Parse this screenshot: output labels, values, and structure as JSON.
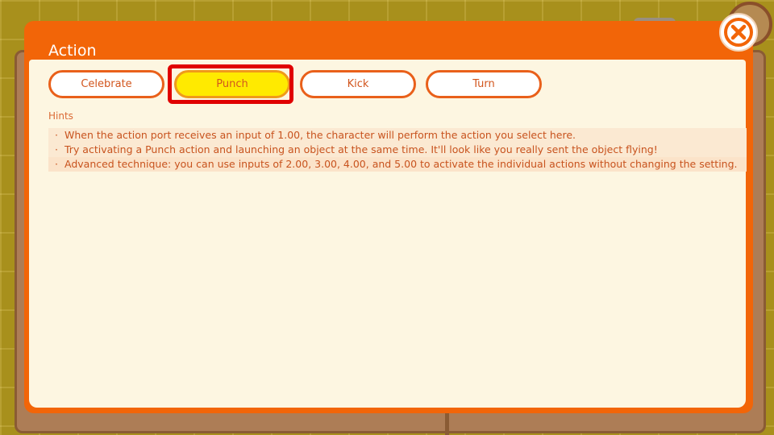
{
  "dialog": {
    "title": "Action",
    "close_icon": "close-x-icon"
  },
  "actions": {
    "options": [
      "Celebrate",
      "Punch",
      "Kick",
      "Turn"
    ],
    "selected": "Punch"
  },
  "hints": {
    "label": "Hints",
    "bullet": "·",
    "items": [
      "When the action port receives an input of 1.00, the character will perform the action you select here.",
      "Try activating a Punch action and launching an object at the same time. It'll look like you really sent the object flying!",
      "Advanced technique: you can use inputs of 2.00, 3.00, 4.00, and 5.00 to activate the individual actions without changing the setting."
    ]
  },
  "colors": {
    "dialog_header": "#f26508",
    "panel_background": "#fdf6e1",
    "selected_fill": "#ffea00",
    "highlight_border": "#e00000",
    "text": "#c8531e"
  }
}
